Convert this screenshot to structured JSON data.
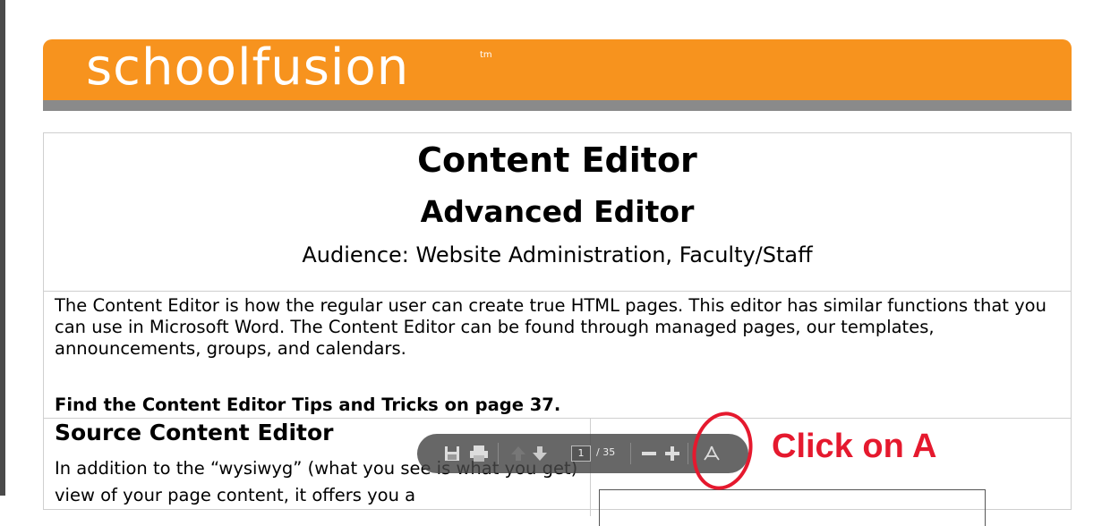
{
  "brand": {
    "logo_text": "schoolfusion",
    "tm": "tm",
    "accent": "#f7931e"
  },
  "document": {
    "title": "Content Editor",
    "subtitle": "Advanced Editor",
    "audience": "Audience: Website Administration, Faculty/Staff",
    "intro": "The Content Editor is how the regular user can create true HTML pages. This editor has similar functions that you can use in Microsoft Word. The Content Editor can be found through managed pages, our templates, announcements, groups, and calendars.",
    "tips": "Find the Content Editor Tips and Tricks on page 37.",
    "section_title": "Source Content Editor",
    "section_body": "In addition to the “wysiwyg” (what you see is what you get) view of your page content, it offers you a"
  },
  "pdf_toolbar": {
    "icons": [
      "save-icon",
      "print-icon",
      "page-up-icon",
      "page-down-icon",
      "zoom-out-icon",
      "zoom-in-icon",
      "acrobat-icon"
    ],
    "current_page": "1",
    "total_pages": "/ 35"
  },
  "annotation": {
    "text": "Click on A",
    "color": "#e5192e"
  }
}
